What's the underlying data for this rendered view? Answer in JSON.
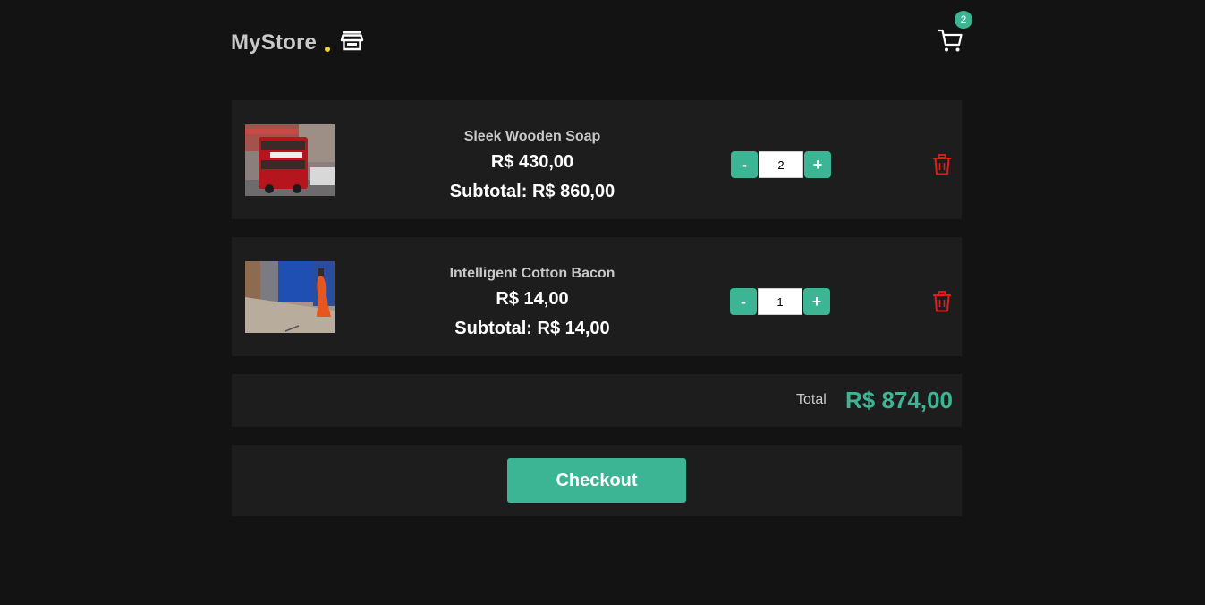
{
  "header": {
    "brand": "MyStore",
    "cart_count": "2",
    "colors": {
      "accent": "#3bb594",
      "dot": "#f2d33b",
      "danger": "#e21b1b"
    }
  },
  "cart": {
    "items": [
      {
        "name": "Sleek Wooden Soap",
        "price": "R$ 430,00",
        "subtotal": "Subtotal: R$ 860,00",
        "quantity": "2",
        "decrement_label": "-",
        "increment_label": "+",
        "image": "red double-decker bus photo"
      },
      {
        "name": "Intelligent Cotton Bacon",
        "price": "R$ 14,00",
        "subtotal": "Subtotal: R$ 14,00",
        "quantity": "1",
        "decrement_label": "-",
        "increment_label": "+",
        "image": "street scene with blue wall and person in orange"
      }
    ],
    "total_label": "Total",
    "total_value": "R$ 874,00",
    "checkout_label": "Checkout"
  }
}
